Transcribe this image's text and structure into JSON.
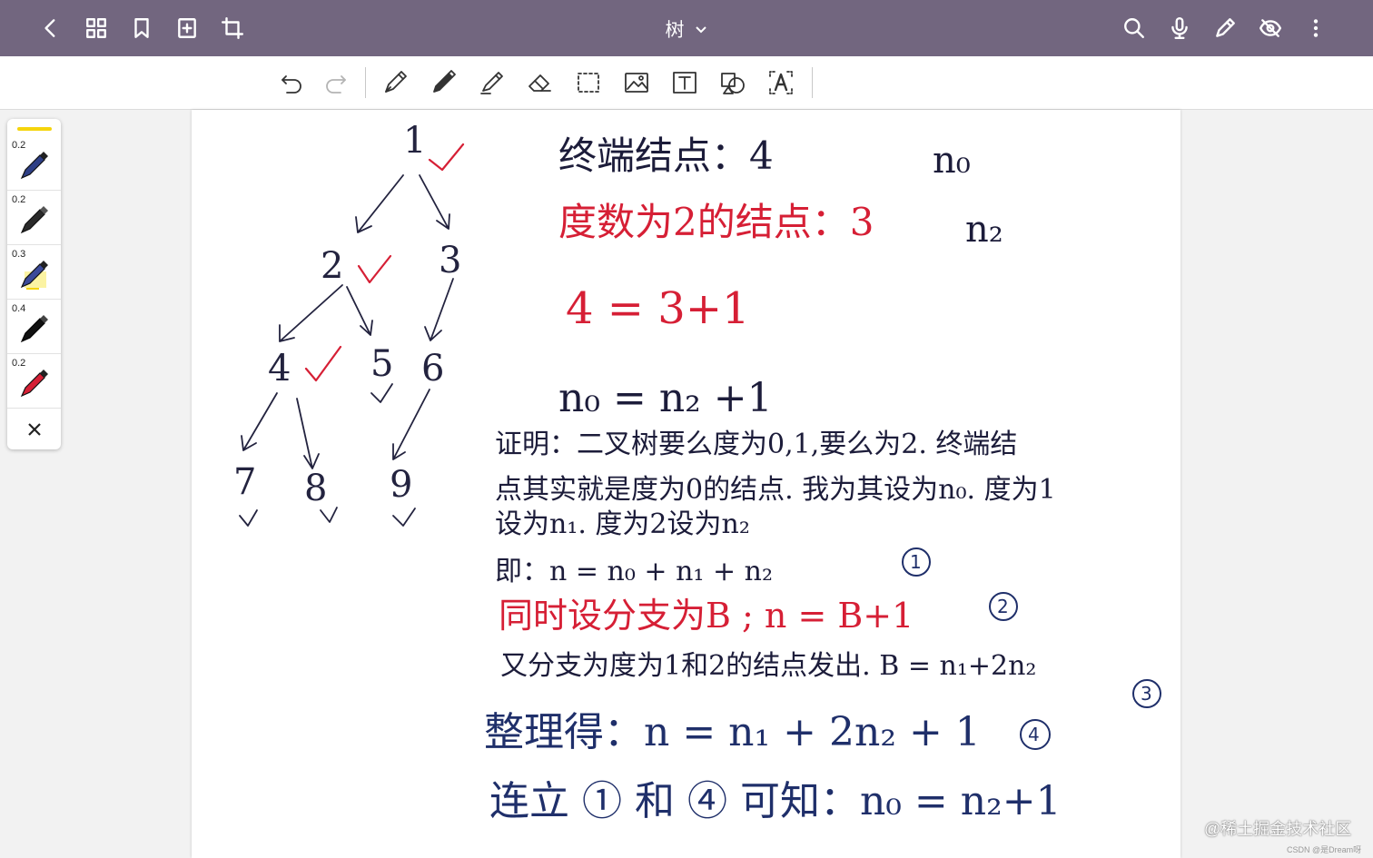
{
  "header": {
    "title": "树"
  },
  "palette": {
    "sizes": [
      "0.2",
      "0.2",
      "0.3",
      "0.4",
      "0.2"
    ]
  },
  "tree": {
    "nodes": [
      "1",
      "2",
      "3",
      "4",
      "5",
      "6",
      "7",
      "8",
      "9"
    ]
  },
  "notes": {
    "line1": "终端结点：4",
    "line1_sym": "n₀",
    "line2": "度数为2的结点：3",
    "line2_sym": "n₂",
    "line3": "4 = 3+1",
    "line4": "n₀ = n₂ +1",
    "proof1": "证明：二叉树要么度为0,1,要么为2. 终端结",
    "proof2": "点其实就是度为0的结点. 我为其设为n₀. 度为1",
    "proof3": "设为n₁. 度为2设为n₂",
    "proof4": "即：n = n₀ + n₁ + n₂",
    "circ1": "①",
    "proof5": "同时设分支为B ; n = B+1",
    "circ2": "②",
    "proof6": "又分支为度为1和2的结点发出. B = n₁+2n₂",
    "circ3": "③",
    "proof7": "整理得：n = n₁ + 2n₂ + 1",
    "circ4": "④",
    "proof8": "连立 ① 和 ④ 可知：n₀ = n₂+1"
  },
  "watermark": "@稀土掘金技术社区",
  "credit": "CSDN @是Dream呀",
  "colors": {
    "topbar": "#72667f",
    "red_ink": "#d61f35",
    "blue_ink": "#1f2f6a",
    "highlight": "#f5d40c"
  }
}
